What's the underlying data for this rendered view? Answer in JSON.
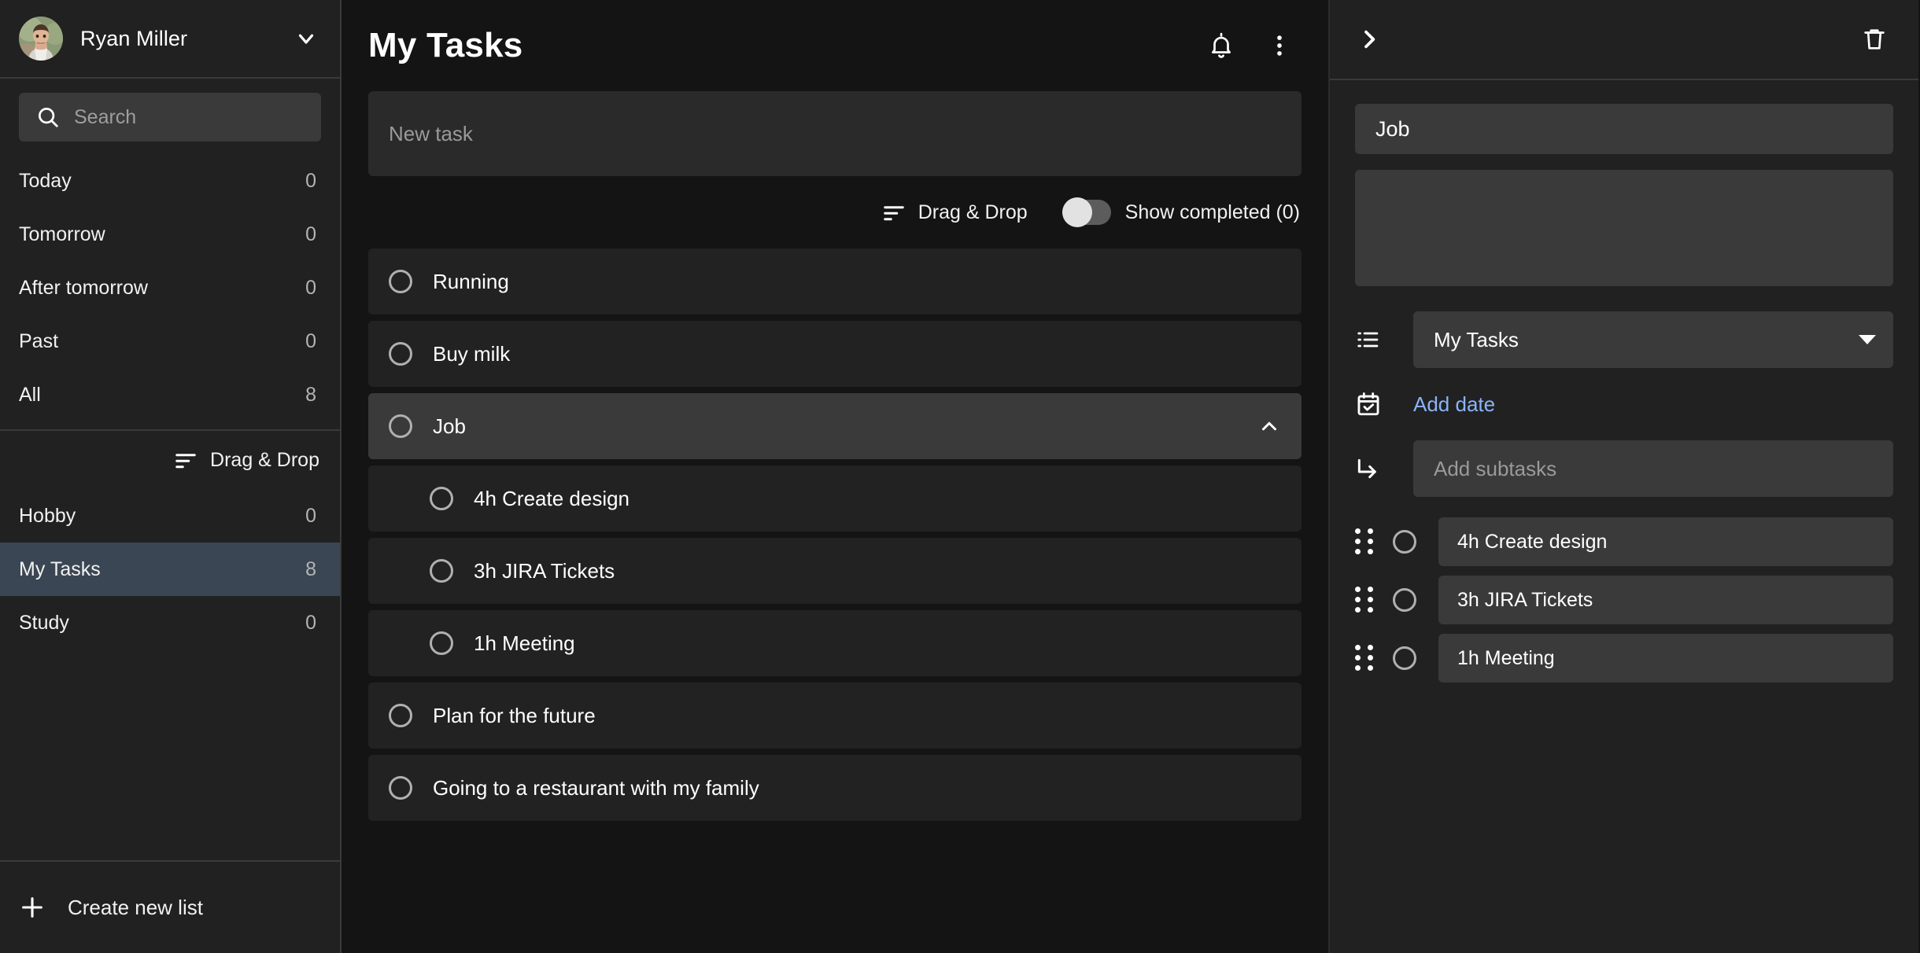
{
  "sidebar": {
    "user": {
      "name": "Ryan Miller",
      "avatar_alt": "user-avatar"
    },
    "search": {
      "placeholder": "Search",
      "value": ""
    },
    "filters": [
      {
        "label": "Today",
        "count": "0"
      },
      {
        "label": "Tomorrow",
        "count": "0"
      },
      {
        "label": "After tomorrow",
        "count": "0"
      },
      {
        "label": "Past",
        "count": "0"
      },
      {
        "label": "All",
        "count": "8"
      }
    ],
    "drag_drop_label": "Drag & Drop",
    "lists": [
      {
        "label": "Hobby",
        "count": "0",
        "active": false
      },
      {
        "label": "My Tasks",
        "count": "8",
        "active": true
      },
      {
        "label": "Study",
        "count": "0",
        "active": false
      }
    ],
    "create_list_label": "Create new list"
  },
  "main": {
    "title": "My Tasks",
    "new_task_placeholder": "New task",
    "new_task_value": "",
    "toolbar": {
      "drag_drop_label": "Drag & Drop",
      "show_completed_label": "Show completed (0)",
      "show_completed_on": false
    },
    "tasks": [
      {
        "title": "Running",
        "sub": false,
        "selected": false,
        "expanded": false
      },
      {
        "title": "Buy milk",
        "sub": false,
        "selected": false,
        "expanded": false
      },
      {
        "title": "Job",
        "sub": false,
        "selected": true,
        "expanded": true
      },
      {
        "title": "4h Create design",
        "sub": true,
        "selected": false,
        "expanded": false
      },
      {
        "title": "3h JIRA Tickets",
        "sub": true,
        "selected": false,
        "expanded": false
      },
      {
        "title": "1h Meeting",
        "sub": true,
        "selected": false,
        "expanded": false
      },
      {
        "title": "Plan for the future",
        "sub": false,
        "selected": false,
        "expanded": false
      },
      {
        "title": "Going to a restaurant with my family",
        "sub": false,
        "selected": false,
        "expanded": false
      }
    ]
  },
  "detail": {
    "task_title": "Job",
    "description_value": "",
    "description_placeholder": "",
    "list_value": "My Tasks",
    "add_date_label": "Add date",
    "add_subtasks_placeholder": "Add subtasks",
    "subtasks": [
      {
        "title": "4h Create design"
      },
      {
        "title": "3h JIRA Tickets"
      },
      {
        "title": "1h Meeting"
      }
    ]
  },
  "colors": {
    "accent_link": "#8ab4f8",
    "active_item": "#3b4654",
    "panel_bg": "#212121",
    "main_bg": "#141414",
    "field_bg": "#3a3a3a"
  }
}
